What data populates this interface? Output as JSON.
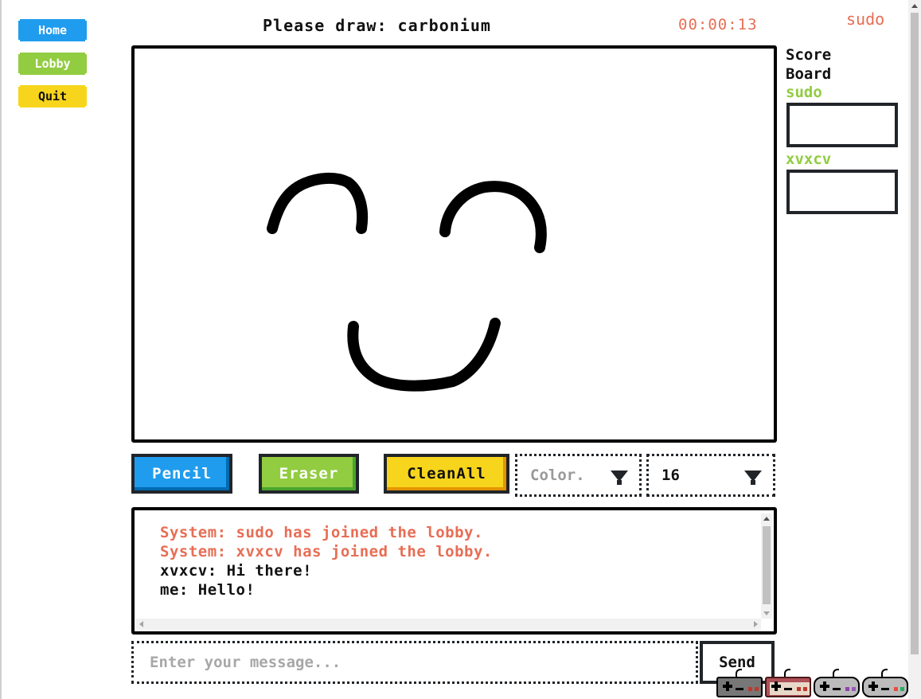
{
  "nav": {
    "home_label": "Home",
    "lobby_label": "Lobby",
    "quit_label": "Quit"
  },
  "header": {
    "prompt": "Please draw: carbonium",
    "timer": "00:00:13",
    "username": "sudo"
  },
  "scoreboard": {
    "title": "Score Board",
    "players": [
      {
        "name": "sudo",
        "score": ""
      },
      {
        "name": "xvxcv",
        "score": ""
      }
    ],
    "name_color": "#92cc41"
  },
  "tools": {
    "pencil_label": "Pencil",
    "eraser_label": "Eraser",
    "clean_label": "CleanAll",
    "color_placeholder": "Color.",
    "size_value": "16"
  },
  "colors": {
    "primary": "#209cee",
    "success": "#92cc41",
    "warning": "#f7d51d",
    "error": "#e76e55",
    "stroke": "#000000"
  },
  "chat": {
    "messages": [
      {
        "text": "System: sudo has joined the lobby.",
        "type": "system"
      },
      {
        "text": "System: xvxcv has joined the lobby.",
        "type": "system"
      },
      {
        "text": "xvxcv: Hi there!",
        "type": "user"
      },
      {
        "text": "me: Hello!",
        "type": "user"
      }
    ],
    "input_placeholder": "Enter your message...",
    "send_label": "Send"
  },
  "controllers": [
    "nes-controller-icon",
    "famicom-controller-icon",
    "snes-controller-icon",
    "sfc-controller-icon"
  ]
}
